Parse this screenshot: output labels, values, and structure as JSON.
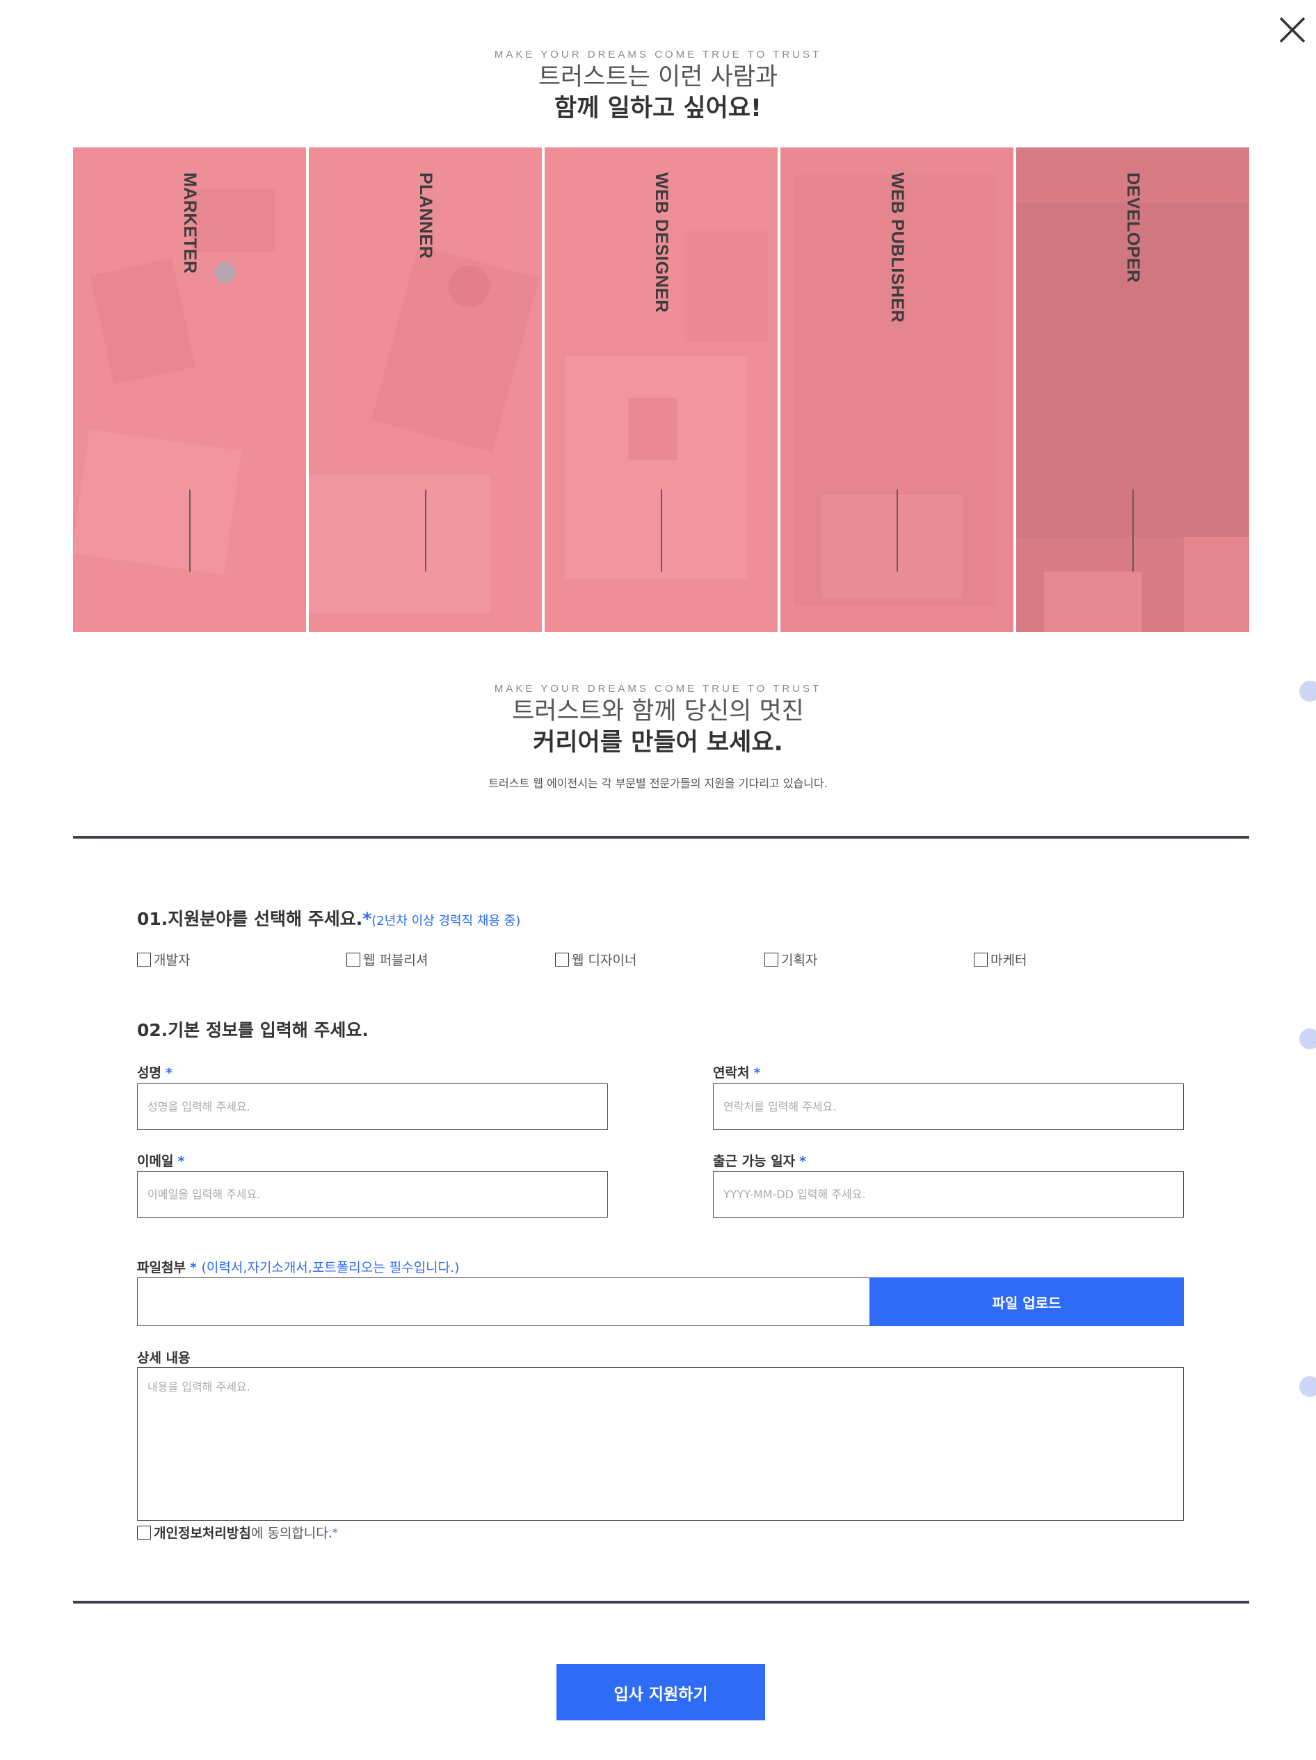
{
  "hero": {
    "eyebrow": "MAKE YOUR DREAMS COME TRUE TO TRUST",
    "line1": "트러스트는 이런 사람과",
    "line2": "함께 일하고 싶어요!"
  },
  "positions": [
    {
      "label": "MARKETER"
    },
    {
      "label": "PLANNER"
    },
    {
      "label": "WEB DESIGNER"
    },
    {
      "label": "WEB PUBLISHER"
    },
    {
      "label": "DEVELOPER"
    }
  ],
  "career": {
    "eyebrow": "MAKE YOUR DREAMS COME TRUE TO TRUST",
    "line1": "트러스트와 함께 당신의 멋진",
    "line2": "커리어를 만들어 보세요.",
    "subtitle": "트러스트 웹 에이전시는 각 부문별 전문가들의 지원을 기다리고 있습니다."
  },
  "step1": {
    "title": "01.지원분야를 선택해 주세요.",
    "required_mark": "*",
    "note": "(2년차 이상 경력직 채용 중)",
    "options": [
      "개발자",
      "웹 퍼블리셔",
      "웹 디자이너",
      "기획자",
      "마케터"
    ]
  },
  "step2": {
    "title": "02.기본 정보를 입력해 주세요.",
    "required_mark": "*",
    "name_label": "성명",
    "name_placeholder": "성명을 입력해 주세요.",
    "phone_label": "연락처",
    "phone_placeholder": "연락처를 입력해 주세요.",
    "email_label": "이메일",
    "email_placeholder": "이메일을 입력해 주세요.",
    "date_label": "출근 가능 일자",
    "date_placeholder": "YYYY-MM-DD 입력해 주세요.",
    "file_label": "파일첨부",
    "file_note": "(이력서,자기소개서,포트폴리오는 필수입니다.)",
    "upload_button": "파일 업로드",
    "detail_label": "상세 내용",
    "detail_placeholder": "내용을 입력해 주세요.",
    "privacy_bold": "개인정보처리방침",
    "privacy_rest": "에 동의합니다."
  },
  "submit_label": "입사 지원하기",
  "icons": {
    "close": "close-icon"
  },
  "colors": {
    "accent": "#2f6cf6",
    "panel": "#ee8f98",
    "highlight": "#f2dbdc",
    "divider": "#3f3f4b"
  }
}
